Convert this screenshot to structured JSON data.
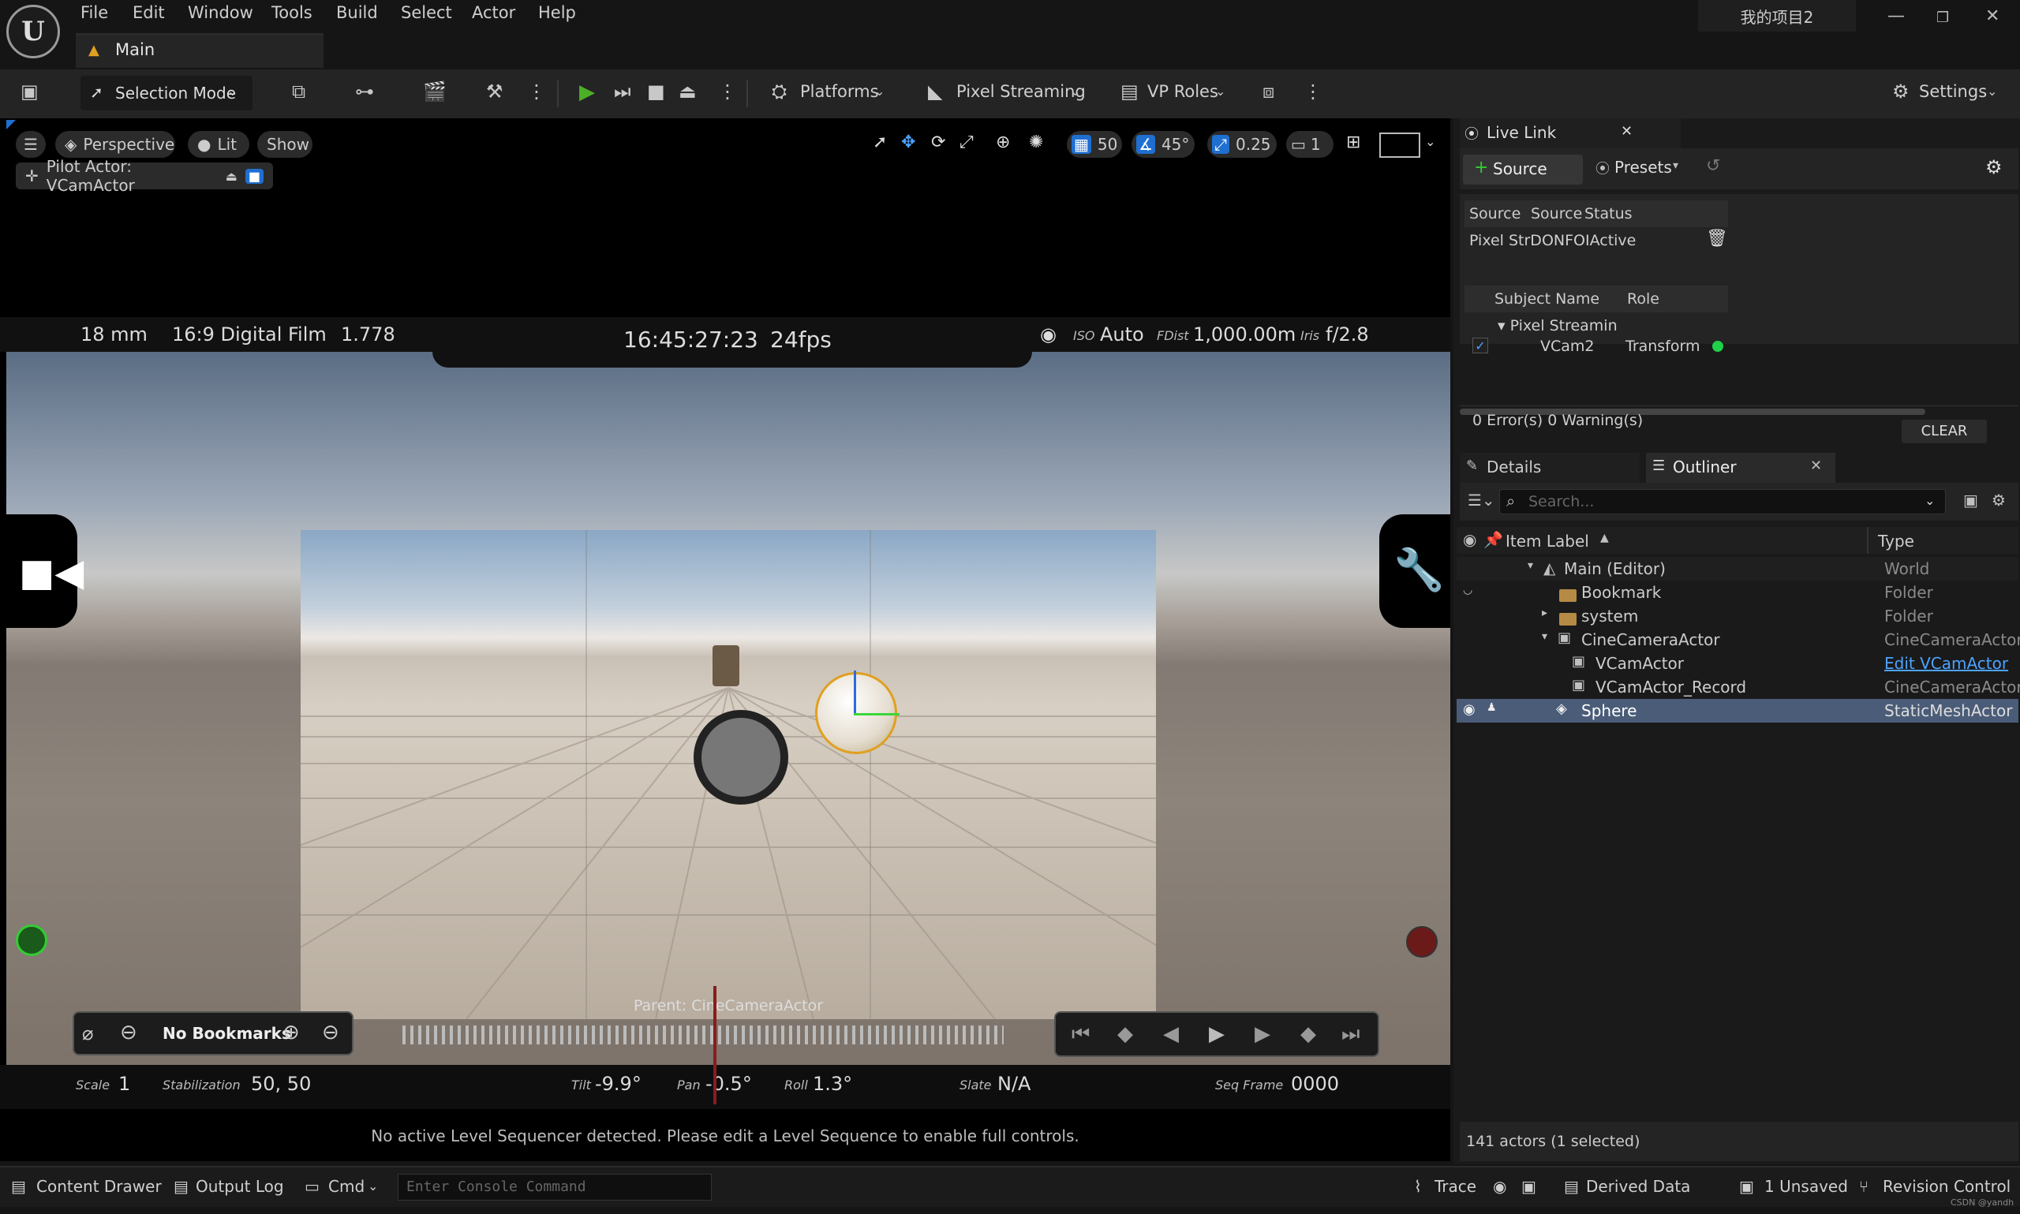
{
  "menubar": {
    "items": [
      "File",
      "Edit",
      "Window",
      "Tools",
      "Build",
      "Select",
      "Actor",
      "Help"
    ],
    "project_name": "我的项目2",
    "level_tab": "Main"
  },
  "toolbar": {
    "selection_mode": "Selection Mode",
    "platforms": "Platforms",
    "pixel_streaming": "Pixel Streaming",
    "vp_roles": "VP Roles",
    "settings": "Settings"
  },
  "viewport": {
    "perspective": "Perspective",
    "lit": "Lit",
    "show": "Show",
    "pilot_actor": "Pilot Actor: VCamActor",
    "grid_snap": "50",
    "rot_snap": "45°",
    "scale_snap": "0.25",
    "camera_speed": "1",
    "hud": {
      "focal_length": "18 mm",
      "film_back": "16:9 Digital Film",
      "aspect": "1.778",
      "timecode": "16:45:27:23",
      "fps": "24fps",
      "iso_label": "ISO",
      "iso_value": "Auto",
      "fdist_label": "FDist",
      "fdist_value": "1,000.00m",
      "iris_label": "Iris",
      "iris_value": "f/2.8",
      "parent": "Parent: CineCameraActor",
      "bookmarks": "No Bookmarks",
      "scale_label": "Scale",
      "scale_value": "1",
      "stabilization_label": "Stabilization",
      "stabilization_value": "50, 50",
      "tilt_label": "Tilt",
      "tilt_value": "-9.9°",
      "pan_label": "Pan",
      "pan_value": "-0.5°",
      "roll_label": "Roll",
      "roll_value": "1.3°",
      "slate_label": "Slate",
      "slate_value": "N/A",
      "seq_frame_label": "Seq Frame",
      "seq_frame_value": "0000",
      "sequencer_message": "No active Level Sequencer detected. Please edit a Level Sequence to enable full controls."
    }
  },
  "live_link": {
    "tab": "Live Link",
    "source_button": "Source",
    "presets_button": "Presets",
    "source_table": {
      "headers": [
        "Source",
        "Source",
        "Status"
      ],
      "row": "Pixel StrDONFOIActive"
    },
    "subject_table": {
      "headers": [
        "Subject Name",
        "Role"
      ],
      "group": "Pixel Streamin",
      "subject": "VCam2",
      "role": "Transform"
    },
    "errors": "0 Error(s)  0 Warning(s)",
    "clear": "CLEAR"
  },
  "outliner": {
    "details_tab": "Details",
    "outliner_tab": "Outliner",
    "search_placeholder": "Search...",
    "col_label": "Item Label",
    "col_type": "Type",
    "rows": [
      {
        "label": "Main (Editor)",
        "type": "World"
      },
      {
        "label": "Bookmark",
        "type": "Folder"
      },
      {
        "label": "system",
        "type": "Folder"
      },
      {
        "label": "CineCameraActor",
        "type": "CineCameraActor"
      },
      {
        "label": "VCamActor",
        "type": "Edit VCamActor"
      },
      {
        "label": "VCamActor_Record",
        "type": "CineCameraActor"
      },
      {
        "label": "Sphere",
        "type": "StaticMeshActor"
      }
    ],
    "footer": "141 actors (1 selected)"
  },
  "statusbar": {
    "content_drawer": "Content Drawer",
    "output_log": "Output Log",
    "cmd": "Cmd",
    "console_placeholder": "Enter Console Command",
    "trace": "Trace",
    "derived_data": "Derived Data",
    "unsaved": "1 Unsaved",
    "revision_control": "Revision Control",
    "watermark": "CSDN @yandh"
  },
  "colors": {
    "accent_blue": "#1f6fd1",
    "play_green": "#4caf27",
    "status_green": "#1fd14a",
    "record_red": "#6b1a1a",
    "link_blue": "#4da3ff"
  }
}
